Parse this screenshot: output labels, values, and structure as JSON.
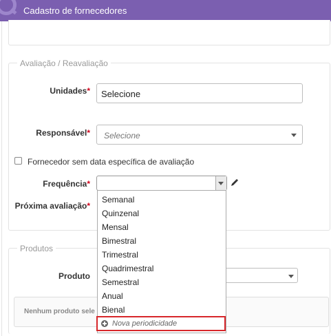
{
  "window": {
    "title": "Cadastro de fornecedores"
  },
  "avaliacao": {
    "legend": "Avaliação / Reavaliação",
    "unidades_label": "Unidades",
    "unidades_value": "Selecione",
    "responsavel_label": "Responsável",
    "responsavel_placeholder": "Selecione",
    "checkbox_label": "Fornecedor sem data específica de avaliação",
    "frequencia_label": "Frequência",
    "frequencia_value": "",
    "proxima_label": "Próxima avaliação",
    "required_mark": "*"
  },
  "produtos": {
    "legend": "Produtos",
    "produto_label": "Produto",
    "empty_text": "Nenhum produto sele"
  },
  "frequencia_dropdown": {
    "options": [
      "Semanal",
      "Quinzenal",
      "Mensal",
      "Bimestral",
      "Trimestral",
      "Quadrimestral",
      "Semestral",
      "Anual",
      "Bienal"
    ],
    "new_option": "Nova periodicidade"
  },
  "colors": {
    "titlebar": "#7b5fb0",
    "required": "#d0021b",
    "highlight": "#d7262a"
  },
  "icons": {
    "pencil": "pencil-icon",
    "plus": "plus-circle-icon",
    "caret": "chevron-down-icon"
  }
}
